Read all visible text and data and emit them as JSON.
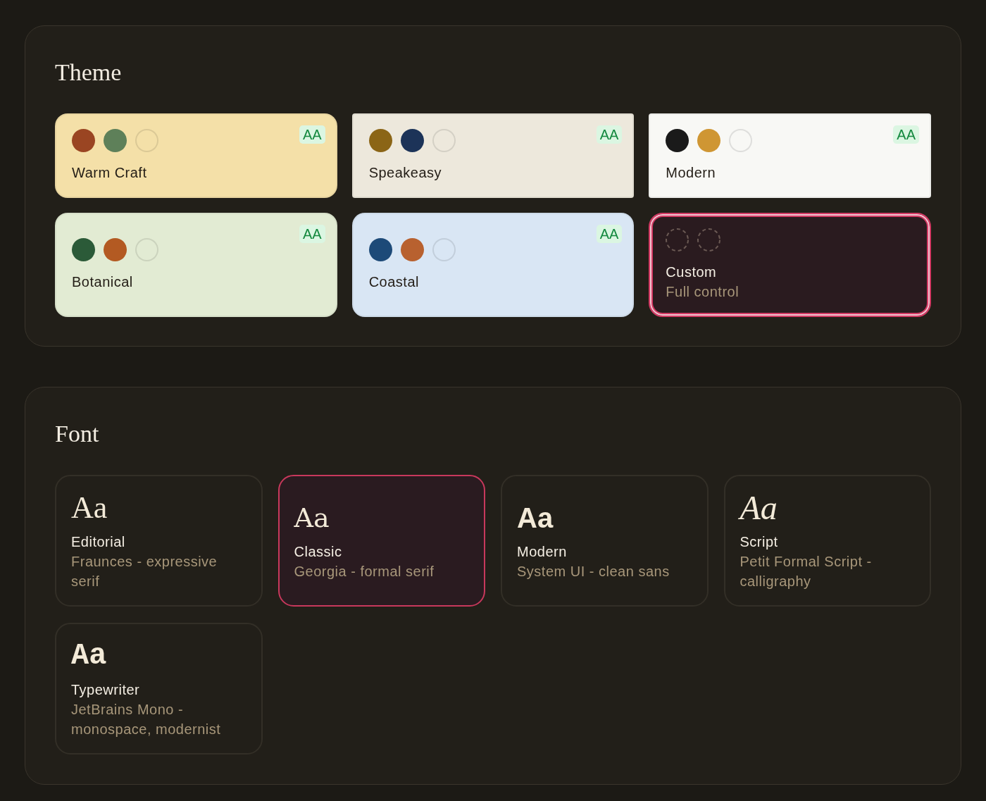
{
  "theme": {
    "title": "Theme",
    "themes": [
      {
        "name": "Warm Craft",
        "kind": "preset",
        "color": "#f4e0a8",
        "rounded": true,
        "badge": "AA",
        "selected": false,
        "swatches": [
          {
            "color": "#9a4522"
          },
          {
            "color": "#5e8059"
          },
          {
            "color": "#f4e0a8"
          }
        ]
      },
      {
        "name": "Speakeasy",
        "kind": "preset",
        "color": "#ede8dc",
        "rounded": false,
        "badge": "AA",
        "selected": false,
        "swatches": [
          {
            "color": "#8b6516"
          },
          {
            "color": "#1c3358"
          },
          {
            "color": "#ede8dc"
          }
        ]
      },
      {
        "name": "Modern",
        "kind": "preset",
        "color": "#f8f8f5",
        "rounded": false,
        "badge": "AA",
        "selected": false,
        "swatches": [
          {
            "color": "#1a1a1a"
          },
          {
            "color": "#cf9633"
          },
          {
            "color": "#f8f8f5"
          }
        ]
      },
      {
        "name": "Botanical",
        "kind": "preset",
        "color": "#e2ebd3",
        "rounded": true,
        "badge": "AA",
        "selected": false,
        "swatches": [
          {
            "color": "#2b5a38"
          },
          {
            "color": "#b35a22"
          },
          {
            "color": "#e2ebd3"
          }
        ]
      },
      {
        "name": "Coastal",
        "kind": "preset",
        "color": "#d9e6f4",
        "rounded": true,
        "badge": "AA",
        "selected": false,
        "swatches": [
          {
            "color": "#1d4a78"
          },
          {
            "color": "#b8612f"
          },
          {
            "color": "#d9e6f4"
          }
        ]
      },
      {
        "name": "Custom",
        "kind": "custom",
        "description": "Full control",
        "selected": true
      }
    ]
  },
  "font": {
    "title": "Font",
    "fonts": [
      {
        "sample": "Aa",
        "name": "Editorial",
        "description": "Fraunces - expressive serif",
        "kind": "display",
        "selected": false
      },
      {
        "sample": "Aa",
        "name": "Classic",
        "description": "Georgia - formal serif",
        "kind": "serif",
        "selected": true
      },
      {
        "sample": "Aa",
        "name": "Modern",
        "description": "System UI - clean sans",
        "kind": "sans",
        "selected": false
      },
      {
        "sample": "Aa",
        "name": "Script",
        "description": "Petit Formal Script - calligraphy",
        "kind": "script",
        "selected": false
      },
      {
        "sample": "Aa",
        "name": "Typewriter",
        "description": "JetBrains Mono - monospace, modernist",
        "kind": "mono",
        "selected": false
      }
    ]
  }
}
